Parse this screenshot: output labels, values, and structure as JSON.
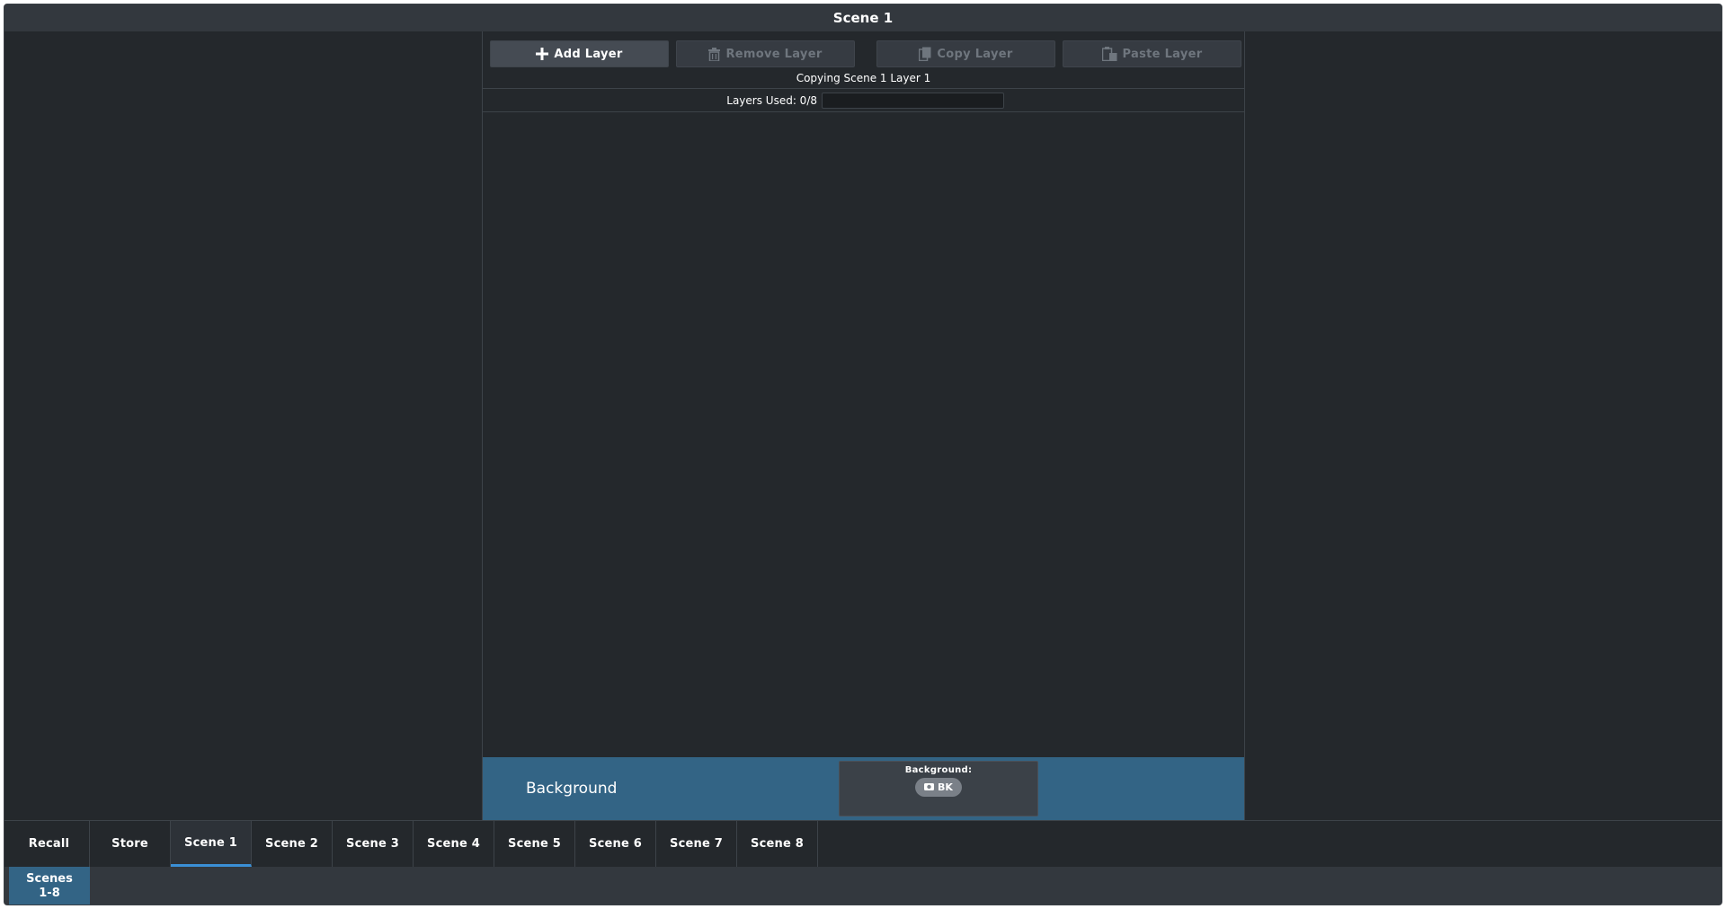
{
  "window": {
    "title": "Scene 1"
  },
  "toolbar": {
    "add_label": "Add Layer",
    "remove_label": "Remove Layer",
    "copy_label": "Copy Layer",
    "paste_label": "Paste Layer"
  },
  "status": {
    "copying": "Copying Scene 1 Layer 1"
  },
  "layers": {
    "label": "Layers Used: 0/8",
    "used_fraction": 0
  },
  "background_strip": {
    "label": "Background",
    "box_title": "Background:",
    "source": "BK"
  },
  "tabs": [
    {
      "label": "Recall"
    },
    {
      "label": "Store"
    },
    {
      "label": "Scene 1",
      "active": true
    },
    {
      "label": "Scene 2"
    },
    {
      "label": "Scene 3"
    },
    {
      "label": "Scene 4"
    },
    {
      "label": "Scene 5"
    },
    {
      "label": "Scene 6"
    },
    {
      "label": "Scene 7"
    },
    {
      "label": "Scene 8"
    }
  ],
  "pages": {
    "line1": "Scenes",
    "line2": "1-8"
  },
  "colors": {
    "accent": "#336485",
    "active_tab_underline": "#3a8fd6",
    "panel_bg": "#24282c"
  },
  "icons": {
    "add": "plus-icon",
    "remove": "trash-icon",
    "copy": "copy-icon",
    "paste": "paste-icon",
    "source": "camera-icon"
  }
}
